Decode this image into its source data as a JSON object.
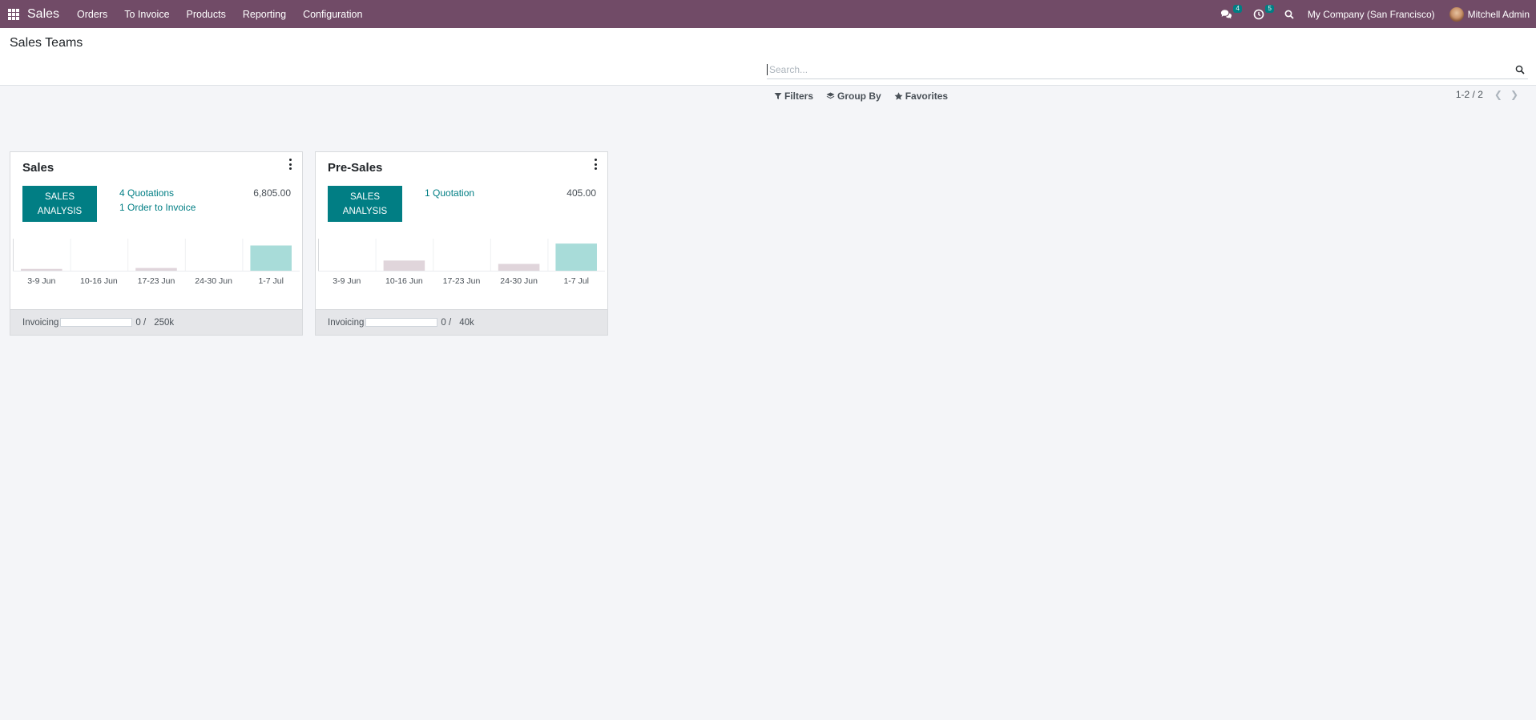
{
  "navbar": {
    "app_name": "Sales",
    "menu": [
      "Orders",
      "To Invoice",
      "Products",
      "Reporting",
      "Configuration"
    ],
    "messages_count": "4",
    "activities_count": "5",
    "company": "My Company (San Francisco)",
    "user": "Mitchell Admin"
  },
  "control_panel": {
    "title": "Sales Teams",
    "search_placeholder": "Search...",
    "filters_label": "Filters",
    "group_by_label": "Group By",
    "favorites_label": "Favorites",
    "pager": "1-2 / 2"
  },
  "cards": [
    {
      "name": "Sales",
      "button_label_1": "SALES",
      "button_label_2": "ANALYSIS",
      "link_1": "4 Quotations",
      "link_2": "1 Order to Invoice",
      "amount": "6,805.00",
      "footer_label": "Invoicing",
      "footer_value": "0 /",
      "footer_target": "250k",
      "progress": 0,
      "chart_data": {
        "type": "bar",
        "categories": [
          "3-9 Jun",
          "10-16 Jun",
          "17-23 Jun",
          "24-30 Jun",
          "1-7 Jul"
        ],
        "values": [
          1,
          0,
          1.5,
          0,
          14
        ],
        "ylim": [
          0,
          16
        ],
        "colors": [
          "#e0d5db",
          "#e0d5db",
          "#e0d5db",
          "#e0d5db",
          "#a8dcd9"
        ]
      }
    },
    {
      "name": "Pre-Sales",
      "button_label_1": "SALES",
      "button_label_2": "ANALYSIS",
      "link_1": "1 Quotation",
      "link_2": "",
      "amount": "405.00",
      "footer_label": "Invoicing",
      "footer_value": "0 /",
      "footer_target": "40k",
      "progress": 0,
      "chart_data": {
        "type": "bar",
        "categories": [
          "3-9 Jun",
          "10-16 Jun",
          "17-23 Jun",
          "24-30 Jun",
          "1-7 Jul"
        ],
        "values": [
          0,
          6,
          0,
          4,
          16
        ],
        "ylim": [
          0,
          17
        ],
        "colors": [
          "#e0d5db",
          "#e0d5db",
          "#e0d5db",
          "#e0d5db",
          "#a8dcd9"
        ]
      }
    }
  ]
}
